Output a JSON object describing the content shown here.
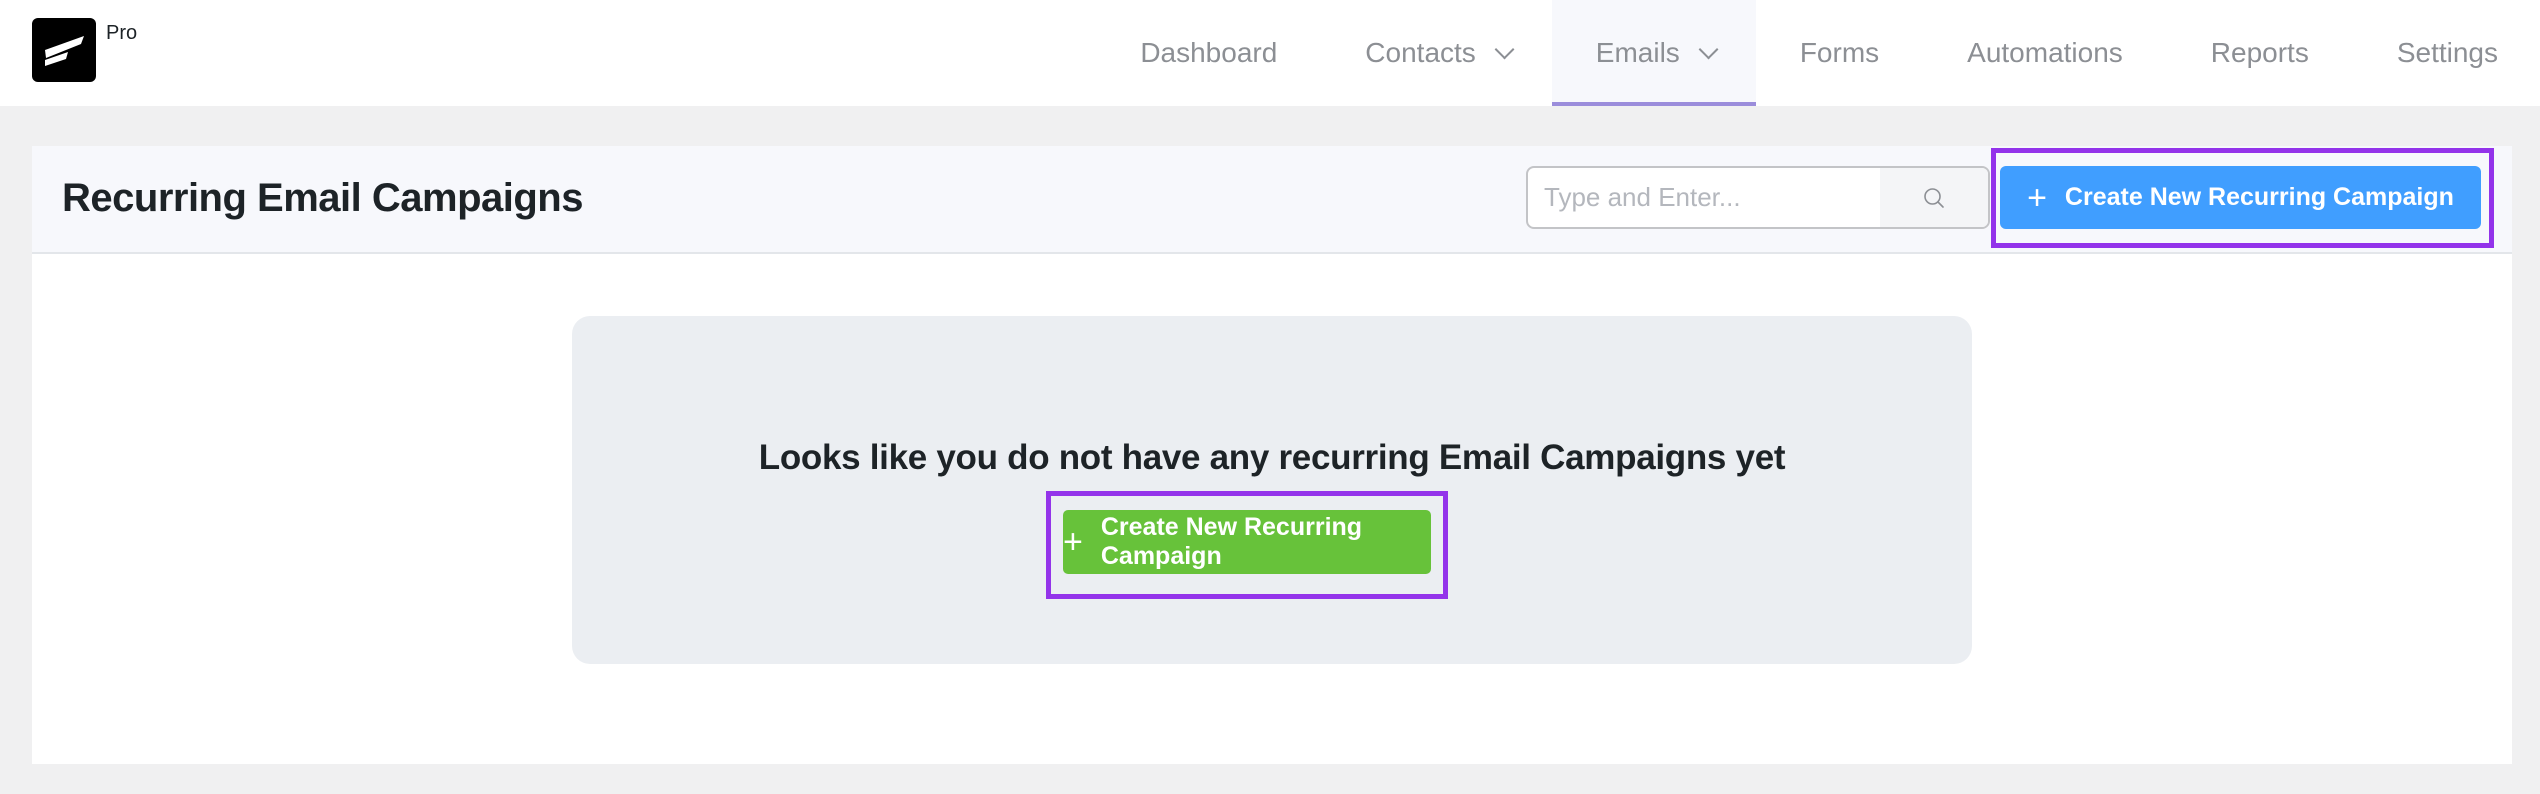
{
  "app": {
    "badge": "Pro",
    "logo_icon": "fluentcrm-logo-icon"
  },
  "nav": {
    "items": [
      {
        "label": "Dashboard",
        "has_dropdown": false,
        "active": false
      },
      {
        "label": "Contacts",
        "has_dropdown": true,
        "active": false
      },
      {
        "label": "Emails",
        "has_dropdown": true,
        "active": true
      },
      {
        "label": "Forms",
        "has_dropdown": false,
        "active": false
      },
      {
        "label": "Automations",
        "has_dropdown": false,
        "active": false
      },
      {
        "label": "Reports",
        "has_dropdown": false,
        "active": false
      },
      {
        "label": "Settings",
        "has_dropdown": false,
        "active": false
      }
    ]
  },
  "header": {
    "title": "Recurring Email Campaigns",
    "search": {
      "placeholder": "Type and Enter...",
      "value": "",
      "icon": "search-icon"
    },
    "create_button": {
      "label": "Create New Recurring Campaign",
      "icon": "plus-icon",
      "color": "#409eff"
    }
  },
  "empty_state": {
    "message": "Looks like you do not have any recurring Email Campaigns yet",
    "create_button": {
      "label": "Create New Recurring Campaign",
      "icon": "plus-icon",
      "color": "#67c23a"
    }
  },
  "colors": {
    "highlight": "#9333ea",
    "active_tab_underline": "#9b8ddb"
  }
}
